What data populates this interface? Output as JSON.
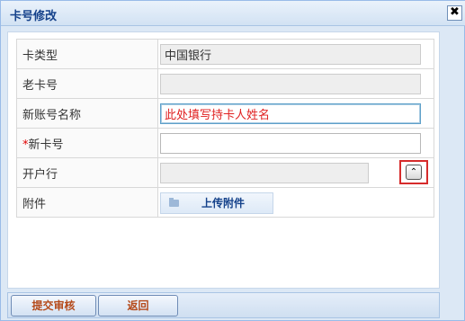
{
  "window": {
    "title": "卡号修改",
    "close_label": "✖"
  },
  "form": {
    "rows": [
      {
        "label": "卡类型",
        "value": "中国银行"
      },
      {
        "label": "老卡号",
        "value": ""
      },
      {
        "label": "新账号名称",
        "value": "此处填写持卡人姓名"
      },
      {
        "required_mark": "*",
        "label": "新卡号",
        "value": ""
      },
      {
        "label": "开户行",
        "value": "",
        "picker_symbol": "⌃"
      },
      {
        "label": "附件",
        "upload_label": "上传附件"
      }
    ]
  },
  "footer": {
    "submit_label": "提交审核",
    "back_label": "返回"
  }
}
